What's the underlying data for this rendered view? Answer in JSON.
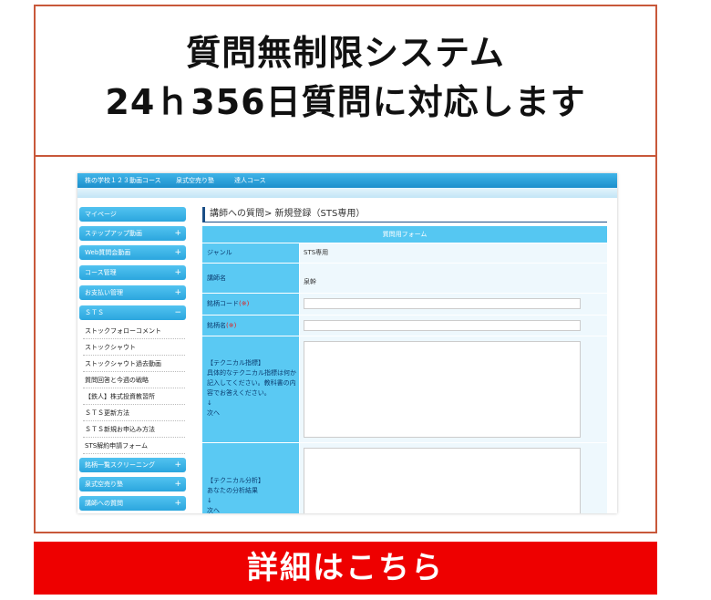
{
  "promo": {
    "headline_line1": "質問無制限システム",
    "headline_line2": "24ｈ356日質問に対応します",
    "cta_label": "詳細はこちら",
    "accent_color": "#c8583a",
    "cta_color": "#ee0000"
  },
  "screenshot": {
    "topnav": [
      "株の学校１２３動画コース",
      "泉式空売り塾",
      "達人コース"
    ],
    "sidebar": {
      "buttons_top": [
        {
          "label": "マイページ",
          "plus": ""
        },
        {
          "label": "ステップアップ動画",
          "plus": "+"
        },
        {
          "label": "Web質問会動画",
          "plus": "+"
        },
        {
          "label": "コース管理",
          "plus": "+"
        },
        {
          "label": "お支払い管理",
          "plus": "+"
        },
        {
          "label": "ＳＴＳ",
          "plus": "−"
        }
      ],
      "sts_items": [
        "ストックフォローコメント",
        "ストックシャウト",
        "ストックシャウト過去動画",
        "質問回答と今週の戦略",
        "【鉄人】株式投資教習所",
        "ＳＴＳ更新方法",
        "ＳＴＳ新規お申込み方法",
        "STS解約申請フォーム"
      ],
      "buttons_bottom": [
        {
          "label": "銘柄一覧スクリーニング",
          "plus": "+"
        },
        {
          "label": "泉式空売り塾",
          "plus": "+"
        },
        {
          "label": "講師への質問",
          "plus": "+"
        }
      ]
    },
    "main": {
      "title": "講師への質問> 新規登録（STS専用）",
      "form_header": "質問用フォーム",
      "genre_label": "ジャンル",
      "genre_value": "STS専用",
      "teacher_label": "講師名",
      "teacher_value": "泉幹",
      "code_label": "銘柄コード",
      "name_label": "銘柄名",
      "required_mark": "(※)",
      "technical_indicator_label": "【テクニカル指標】\n具体的なテクニカル指標は何か記入してください。教科書の内容でお答えください。\n↓\n次へ",
      "technical_analysis_label": "【テクニカル分析】\nあなたの分析結果\n↓\n次へ"
    }
  }
}
